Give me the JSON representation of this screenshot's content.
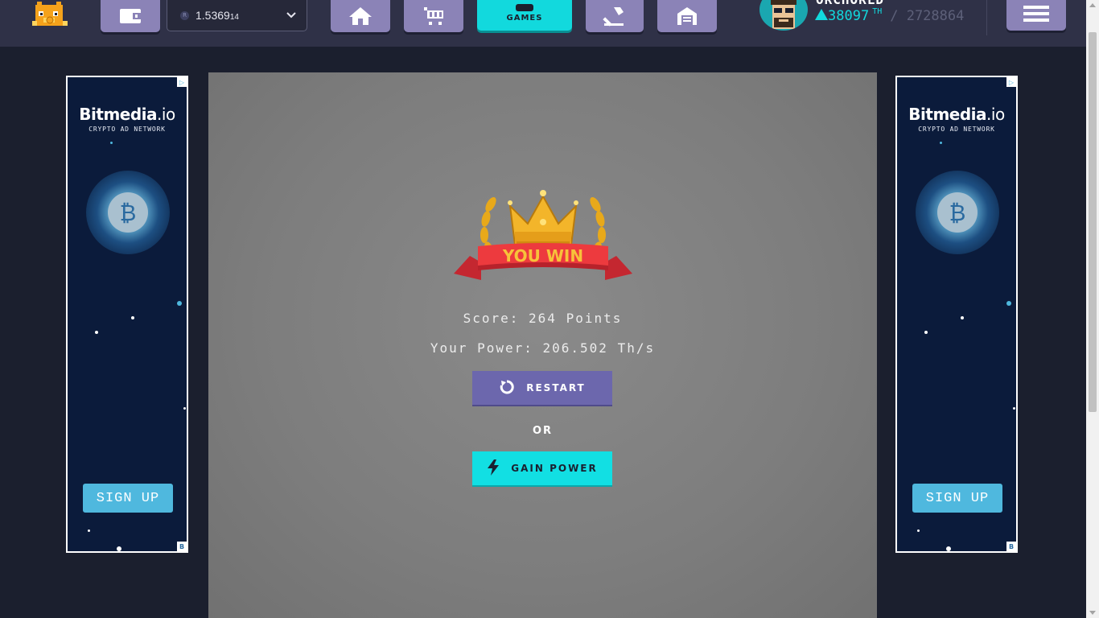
{
  "nav": {
    "balance_main": "1.5369",
    "balance_small": "14",
    "coin_symbol": "R",
    "games_label": "GAMES",
    "items": [
      {
        "name": "wallet",
        "icon": "wallet-icon"
      },
      {
        "name": "home",
        "icon": "home-icon"
      },
      {
        "name": "market",
        "icon": "cart-icon"
      },
      {
        "name": "games",
        "icon": "gamepad-icon"
      },
      {
        "name": "battle",
        "icon": "hammer-icon"
      },
      {
        "name": "rooms",
        "icon": "garage-icon"
      }
    ]
  },
  "user": {
    "name": "ORCHORLD",
    "power": "38097",
    "power_unit": "TH",
    "total": "/ 2728864"
  },
  "ad": {
    "brand_bold": "Bitmedia",
    "brand_light": ".io",
    "tagline": "CRYPTO AD NETWORK",
    "signup": "SIGN UP",
    "coin_symbol": "₿",
    "badge": "B"
  },
  "game": {
    "banner": "YOU WIN",
    "score": "Score: 264 Points",
    "power": "Your Power: 206.502 Th/s",
    "restart_label": "RESTART",
    "or_label": "OR",
    "gain_label": "GAIN POWER"
  },
  "colors": {
    "accent": "#12d9dd",
    "nav_button": "#8b83b7",
    "restart_button": "#6c67ad",
    "ad_signup": "#4fb8de"
  }
}
